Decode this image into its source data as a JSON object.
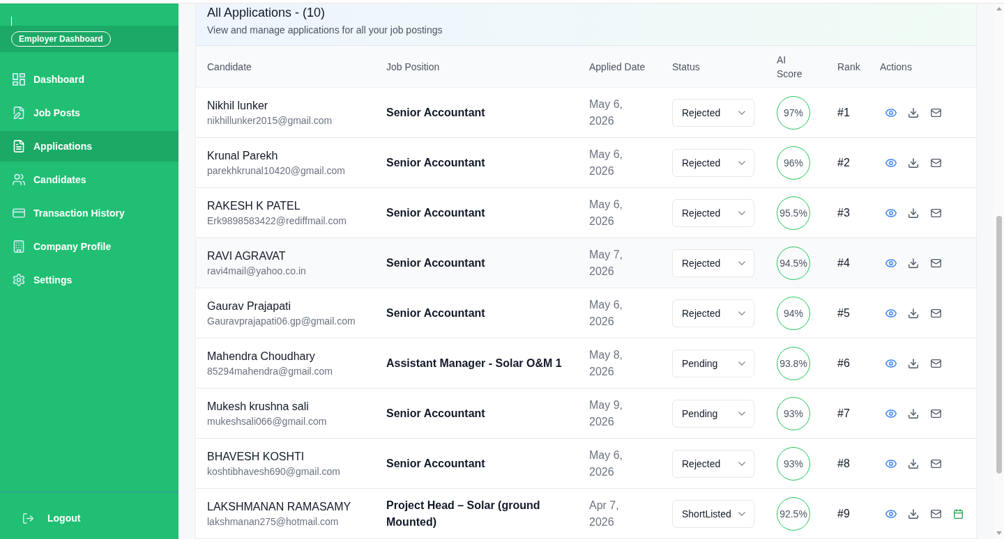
{
  "sidebar": {
    "badge": "Employer Dashboard",
    "nav_items": [
      {
        "label": "Dashboard",
        "selected": false
      },
      {
        "label": "Job Posts",
        "selected": false
      },
      {
        "label": "Applications",
        "selected": true
      },
      {
        "label": "Candidates",
        "selected": false
      },
      {
        "label": "Transaction History",
        "selected": false
      },
      {
        "label": "Company Profile",
        "selected": false
      },
      {
        "label": "Settings",
        "selected": false
      }
    ],
    "logout": {
      "label": "Logout"
    }
  },
  "applications": {
    "title": "All Applications - (10)",
    "subtitle": "View and manage applications for all your job postings",
    "columns": [
      "Candidate",
      "Job Position",
      "Applied Date",
      "Status",
      "AI Score",
      "Rank",
      "Actions"
    ],
    "rows": [
      {
        "name": "Nikhil lunker",
        "email": "nikhillunker2015@gmail.com",
        "position": "Senior Accountant",
        "applied_date": "May 6, 2026",
        "status": "Rejected",
        "ai_score": "97%",
        "rank": "#1",
        "highlighted": false,
        "calendar_action": false
      },
      {
        "name": "Krunal Parekh",
        "email": "parekhkrunal10420@gmail.com",
        "position": "Senior Accountant",
        "applied_date": "May 6, 2026",
        "status": "Rejected",
        "ai_score": "96%",
        "rank": "#2",
        "highlighted": false,
        "calendar_action": false
      },
      {
        "name": "RAKESH K PATEL",
        "email": "Erk9898583422@rediffmail.com",
        "position": "Senior Accountant",
        "applied_date": "May 6, 2026",
        "status": "Rejected",
        "ai_score": "95.5%",
        "rank": "#3",
        "highlighted": false,
        "calendar_action": false
      },
      {
        "name": "RAVI AGRAVAT",
        "email": "ravi4mail@yahoo.co.in",
        "position": "Senior Accountant",
        "applied_date": "May 7, 2026",
        "status": "Rejected",
        "ai_score": "94.5%",
        "rank": "#4",
        "highlighted": true,
        "calendar_action": false
      },
      {
        "name": "Gaurav Prajapati",
        "email": "Gauravprajapati06.gp@gmail.com",
        "position": "Senior Accountant",
        "applied_date": "May 6, 2026",
        "status": "Rejected",
        "ai_score": "94%",
        "rank": "#5",
        "highlighted": false,
        "calendar_action": false
      },
      {
        "name": "Mahendra Choudhary",
        "email": "85294mahendra@gmail.com",
        "position": "Assistant Manager - Solar O&M 1",
        "applied_date": "May 8, 2026",
        "status": "Pending",
        "ai_score": "93.8%",
        "rank": "#6",
        "highlighted": false,
        "calendar_action": false
      },
      {
        "name": "Mukesh krushna sali",
        "email": "mukeshsali066@gmail.com",
        "position": "Senior Accountant",
        "applied_date": "May 9, 2026",
        "status": "Pending",
        "ai_score": "93%",
        "rank": "#7",
        "highlighted": false,
        "calendar_action": false
      },
      {
        "name": "BHAVESH KOSHTI",
        "email": "koshtibhavesh690@gmail.com",
        "position": "Senior Accountant",
        "applied_date": "May 6, 2026",
        "status": "Rejected",
        "ai_score": "93%",
        "rank": "#8",
        "highlighted": false,
        "calendar_action": false
      },
      {
        "name": "LAKSHMANAN RAMASAMY",
        "email": "lakshmanan275@hotmail.com",
        "position": "Project Head – Solar (ground Mounted)",
        "applied_date": "Apr 7, 2026",
        "status": "ShortListed",
        "ai_score": "92.5%",
        "rank": "#9",
        "highlighted": false,
        "calendar_action": true
      }
    ]
  }
}
